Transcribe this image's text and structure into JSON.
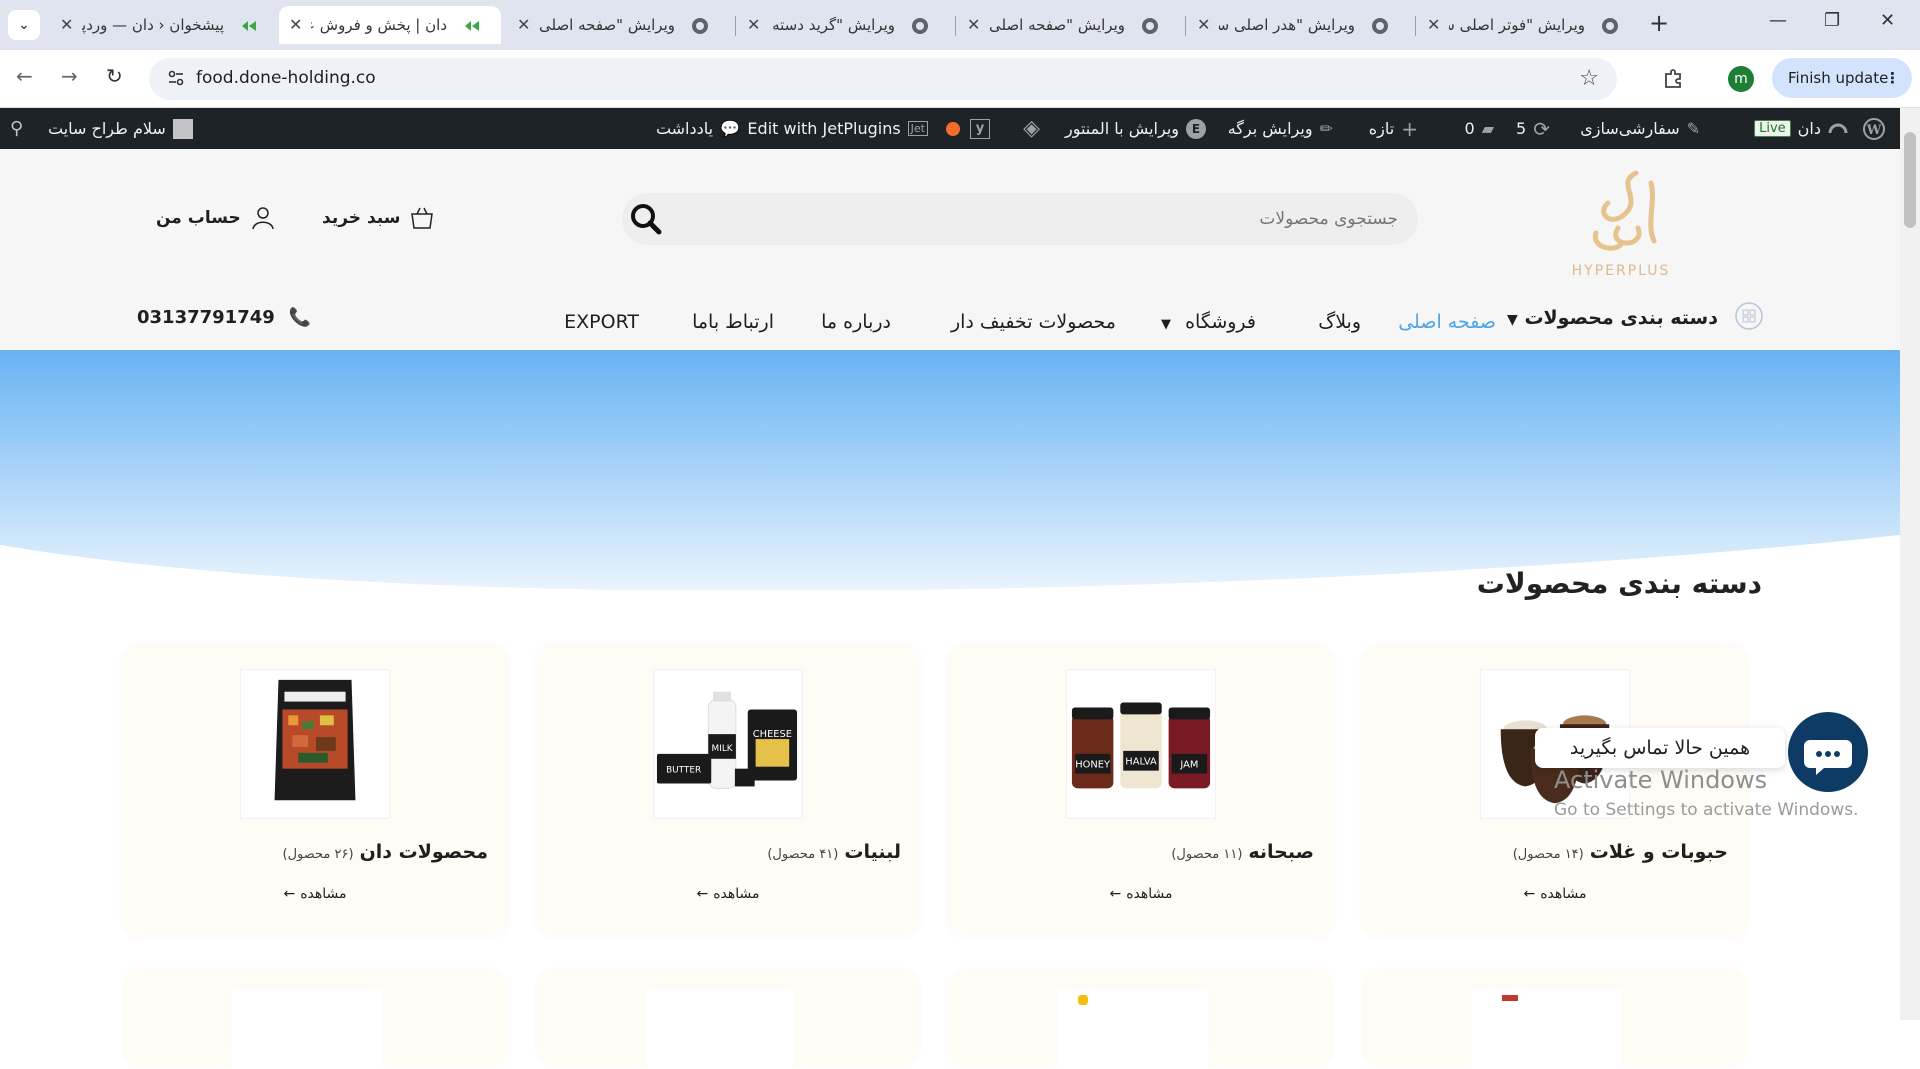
{
  "browser": {
    "tabs": [
      {
        "title": "پیشخوان ‹ دان — وردپرس"
      },
      {
        "title": "دان | پخش و فروش عمده"
      },
      {
        "title": "ویرایش \"صفحه اصلی\""
      },
      {
        "title": "ویرایش \"گرید دسته بندی\""
      },
      {
        "title": "ویرایش \"صفحه اصلی\""
      },
      {
        "title": "ویرایش \"هدر اصلی سایت\""
      },
      {
        "title": "ویرایش \"فوتر اصلی سایت\""
      }
    ],
    "url": "food.done-holding.co",
    "profile_initial": "m",
    "finish_update_label": "Finish update"
  },
  "wpbar": {
    "site_name": "دان",
    "live_badge": "Live",
    "customize": "سفارشی‌سازی",
    "updates_count": "5",
    "comments_count": "0",
    "new_label": "تازه",
    "edit_page": "ویرایش برگه",
    "edit_elementor": "ویرایش با المنتور",
    "jet": "Edit with JetPlugins",
    "notes": "یادداشت",
    "greeting": "سلام طراح سایت"
  },
  "header": {
    "logo_text": "HYPERPLUS",
    "search_placeholder": "جستجوی محصولات",
    "cart_label": "سبد خرید",
    "account_label": "حساب من",
    "menu": {
      "categories": "دسته بندی محصولات",
      "home": "صفحه اصلی",
      "blog": "وبلاگ",
      "shop": "فروشگاه",
      "discount": "محصولات تخفیف دار",
      "about": "درباره ما",
      "contact": "ارتباط باما",
      "export": "EXPORT"
    },
    "phone": "03137791749"
  },
  "section": {
    "title": "دسته بندی محصولات",
    "cards": [
      {
        "name": "حبوبات و غلات",
        "count": "(۱۴ محصول)",
        "view": "مشاهده"
      },
      {
        "name": "صبحانه",
        "count": "(۱۱ محصول)",
        "view": "مشاهده"
      },
      {
        "name": "لبنیات",
        "count": "(۴۱ محصول)",
        "view": "مشاهده"
      },
      {
        "name": "محصولات دان",
        "count": "(۲۶ محصول)",
        "view": "مشاهده"
      }
    ],
    "product_labels": {
      "honey": "HONEY",
      "halva": "HALVA",
      "jam": "JAM",
      "butter": "BUTTER",
      "milk": "MILK",
      "cheese": "CHEESE"
    }
  },
  "chat": {
    "label": "همین حالا تماس بگیرید"
  },
  "watermark": {
    "line1": "Activate Windows",
    "line2": "Go to Settings to activate Windows."
  }
}
